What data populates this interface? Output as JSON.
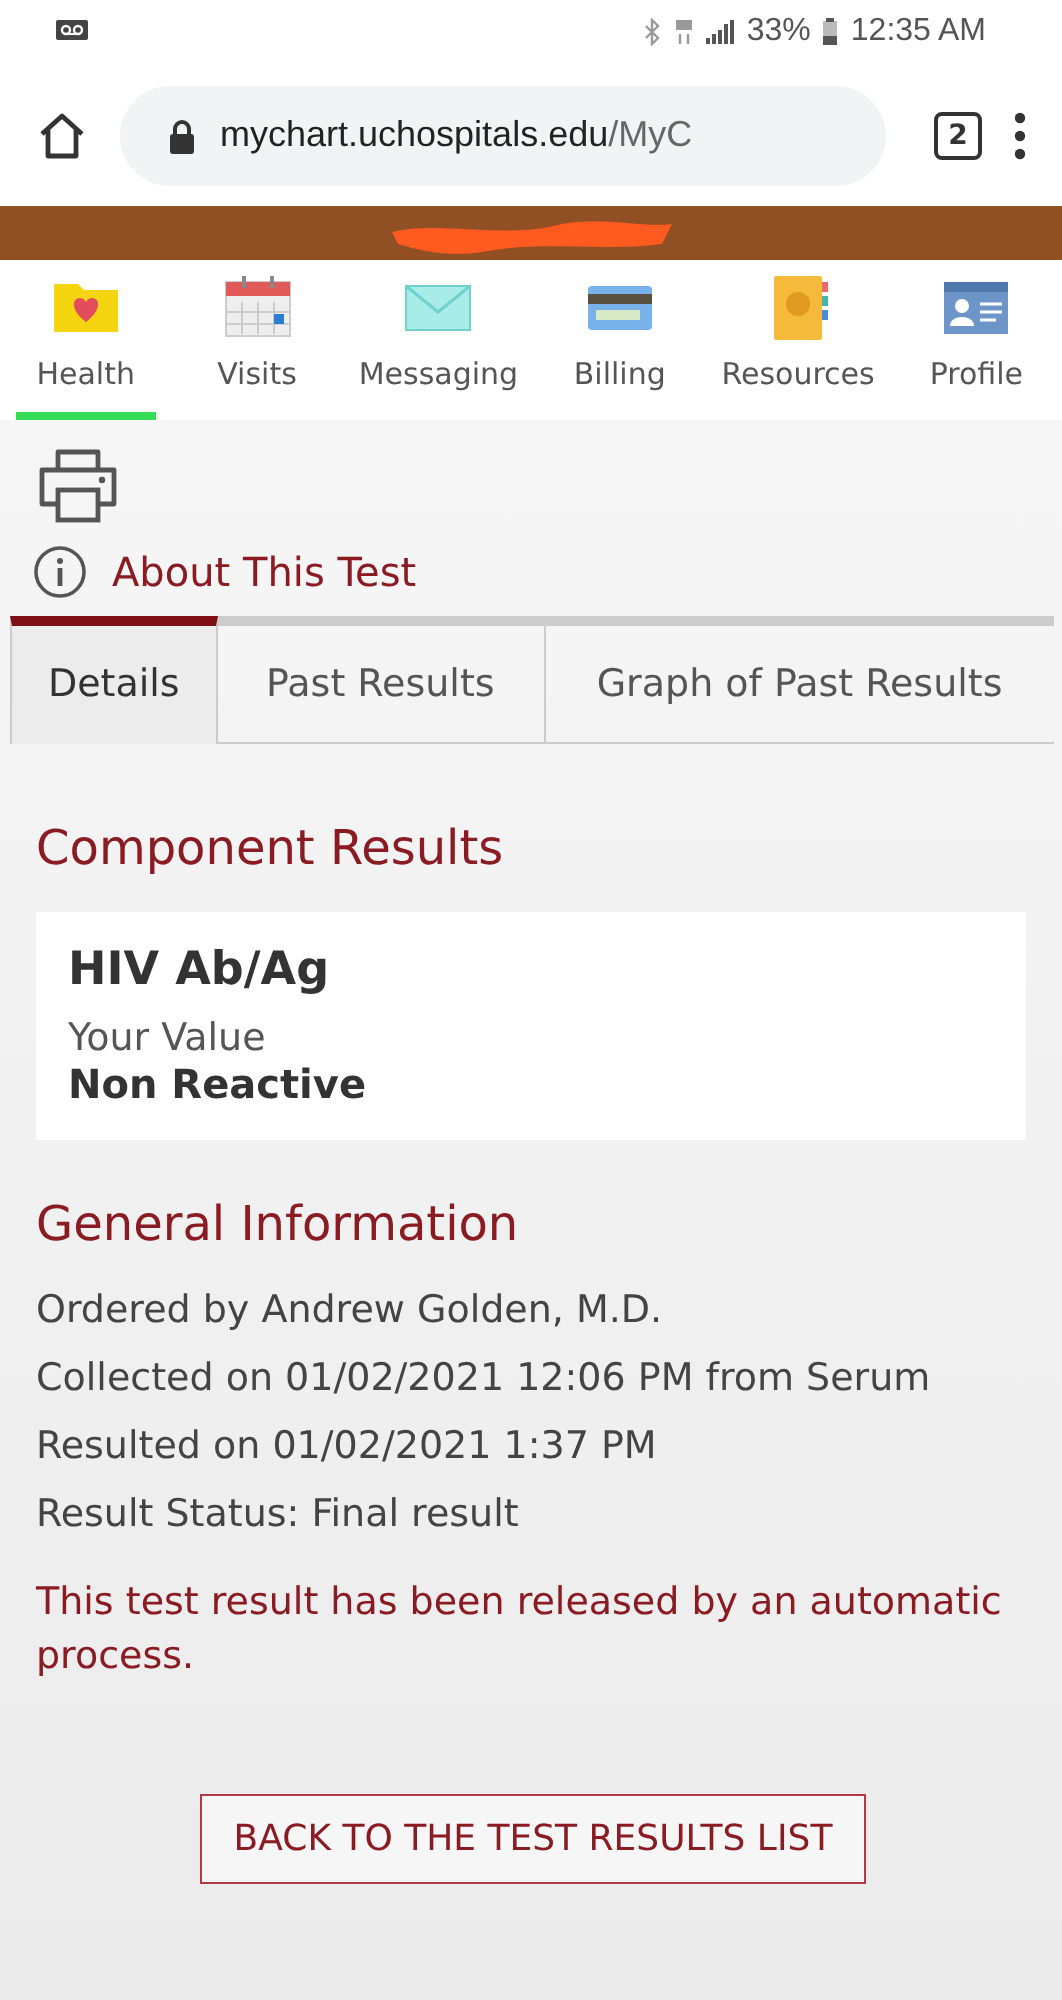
{
  "status_bar": {
    "battery": "33%",
    "time": "12:35 AM"
  },
  "browser": {
    "url_host": "mychart.uchospitals.edu",
    "url_path": "/MyC",
    "tab_count": "2"
  },
  "nav": [
    {
      "label": "Health",
      "kind": "folder-heart",
      "selected": true
    },
    {
      "label": "Visits",
      "kind": "calendar",
      "selected": false
    },
    {
      "label": "Messaging",
      "kind": "envelope",
      "selected": false
    },
    {
      "label": "Billing",
      "kind": "card",
      "selected": false
    },
    {
      "label": "Resources",
      "kind": "book",
      "selected": false
    },
    {
      "label": "Profile",
      "kind": "id-card",
      "selected": false
    }
  ],
  "about_link": "About This Test",
  "tabs": [
    {
      "label": "Details",
      "selected": true
    },
    {
      "label": "Past Results",
      "selected": false
    },
    {
      "label": "Graph of Past Results",
      "selected": false
    }
  ],
  "component_results": {
    "heading": "Component Results",
    "name": "HIV Ab/Ag",
    "value_label": "Your Value",
    "value": "Non Reactive"
  },
  "general_information": {
    "heading": "General Information",
    "lines": [
      "Ordered by Andrew Golden, M.D.",
      "Collected on 01/02/2021 12:06 PM from Serum",
      "Resulted on 01/02/2021 1:37 PM",
      "Result Status: Final result"
    ],
    "notice": "This test result has been released by an automatic process."
  },
  "back_button": "BACK TO THE TEST RESULTS LIST"
}
